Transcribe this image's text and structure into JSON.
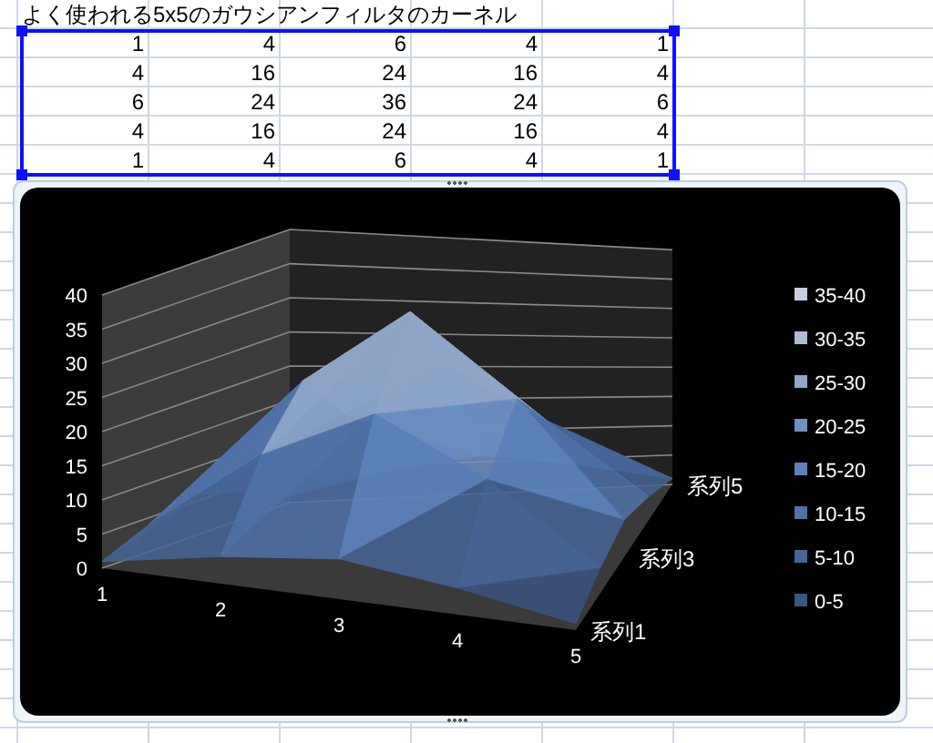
{
  "sheet": {
    "title": "よく使われる5x5のガウシアンフィルタのカーネル",
    "rows": [
      [
        "1",
        "4",
        "6",
        "4",
        "1"
      ],
      [
        "4",
        "16",
        "24",
        "16",
        "4"
      ],
      [
        "6",
        "24",
        "36",
        "24",
        "6"
      ],
      [
        "4",
        "16",
        "24",
        "16",
        "4"
      ],
      [
        "1",
        "4",
        "6",
        "4",
        "1"
      ]
    ]
  },
  "chart": {
    "z_ticks": [
      "40",
      "35",
      "30",
      "25",
      "20",
      "15",
      "10",
      "5",
      "0"
    ],
    "categories": [
      "1",
      "2",
      "3",
      "4",
      "5"
    ],
    "series_labels": [
      "系列5",
      "系列3",
      "系列1"
    ],
    "legend": [
      {
        "label": "35-40",
        "color": "#c8cfe0"
      },
      {
        "label": "30-35",
        "color": "#b0bcd4"
      },
      {
        "label": "25-30",
        "color": "#8fa6c8"
      },
      {
        "label": "20-25",
        "color": "#6f92c4"
      },
      {
        "label": "15-20",
        "color": "#5b82ba"
      },
      {
        "label": "10-15",
        "color": "#4f73a8"
      },
      {
        "label": "5-10",
        "color": "#456696"
      },
      {
        "label": "0-5",
        "color": "#3b5680"
      }
    ]
  }
}
